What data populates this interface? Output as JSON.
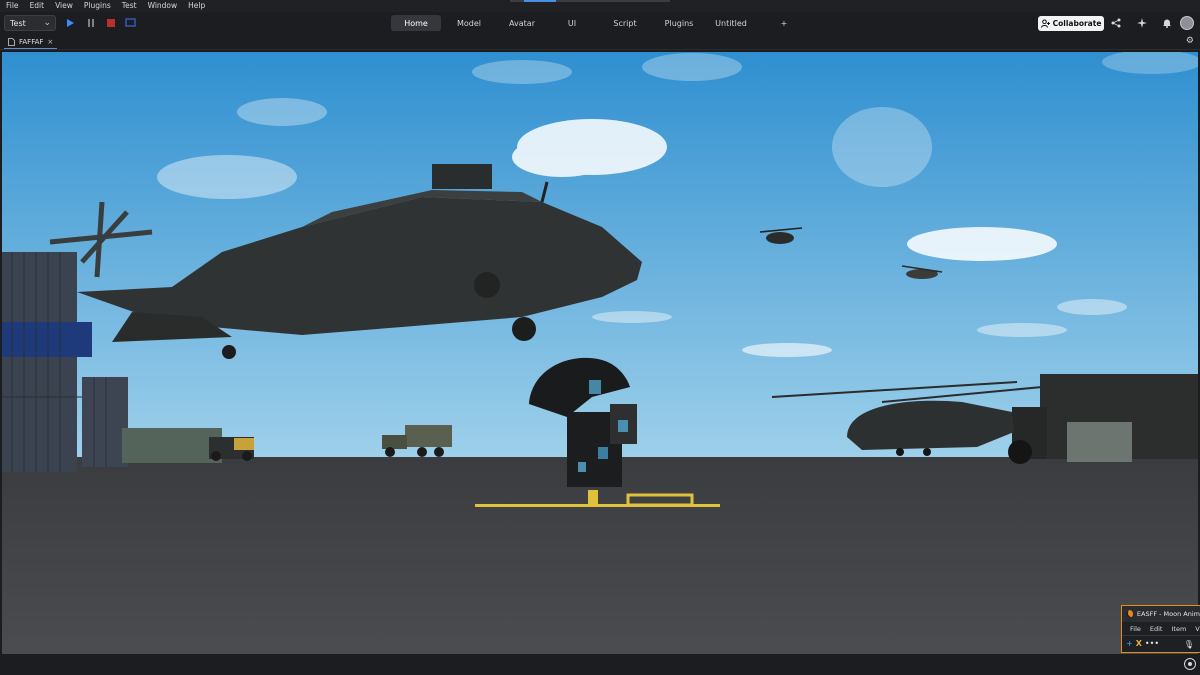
{
  "menu": [
    "File",
    "Edit",
    "View",
    "Plugins",
    "Test",
    "Window",
    "Help"
  ],
  "loading_progress": 0.2,
  "toolbar": {
    "mode_value": "Test",
    "play_icon": "play-icon",
    "pause_icon": "pause-icon",
    "stop_icon": "stop-icon",
    "screen_icon": "screen-icon"
  },
  "tabs": [
    {
      "label": "Home",
      "active": true
    },
    {
      "label": "Model",
      "active": false
    },
    {
      "label": "Avatar",
      "active": false
    },
    {
      "label": "UI",
      "active": false
    },
    {
      "label": "Script",
      "active": false
    },
    {
      "label": "Plugins",
      "active": false
    },
    {
      "label": "Untitled",
      "active": false
    },
    {
      "label": "+",
      "active": false
    }
  ],
  "collaborate_label": "Collaborate",
  "document_tab": {
    "label": "FAFFAF",
    "close": "×"
  },
  "scene": {
    "sky_top": "#2f8fd0",
    "sky_bottom": "#9ed0ea",
    "ground": "#3f4143",
    "marking": "#e0c23a"
  },
  "plugin_panel": {
    "title": "EASFF - Moon Anim",
    "menu": [
      "File",
      "Edit",
      "Item",
      "V"
    ],
    "tools": [
      "+",
      "X",
      "•••"
    ]
  }
}
